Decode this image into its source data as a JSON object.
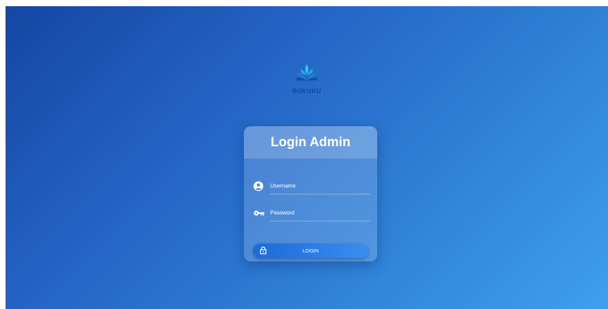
{
  "brand": {
    "name": "BUKUKU",
    "logo_icon": "open-book-lotus-icon"
  },
  "login": {
    "title": "Login Admin",
    "username": {
      "placeholder": "Username",
      "value": "",
      "icon": "user-circle-icon"
    },
    "password": {
      "placeholder": "Password",
      "value": "",
      "icon": "key-icon"
    },
    "submit": {
      "label": "LOGIN",
      "icon": "lock-icon"
    }
  },
  "colors": {
    "bg_start": "#1546a3",
    "bg_end": "#3e9ff0",
    "button": "#1c6ad6",
    "text": "#ffffff"
  }
}
